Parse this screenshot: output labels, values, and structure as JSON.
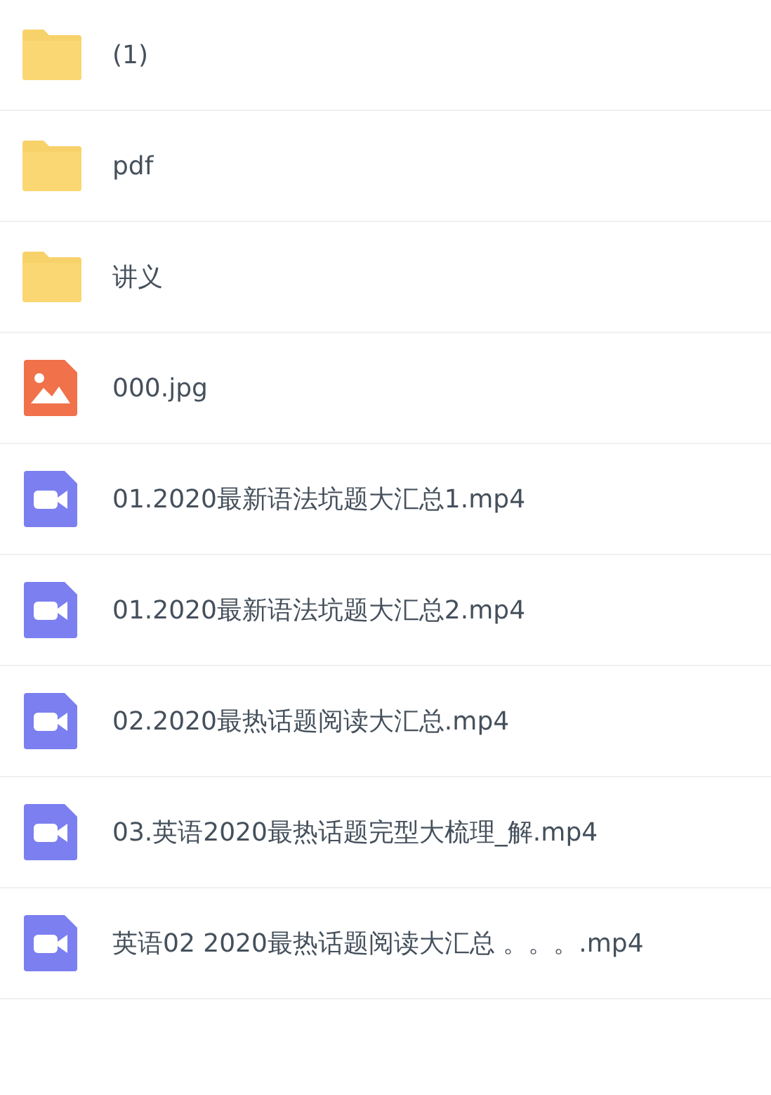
{
  "files": [
    {
      "kind": "folder",
      "name": "(1)"
    },
    {
      "kind": "folder",
      "name": "pdf"
    },
    {
      "kind": "folder",
      "name": "讲义"
    },
    {
      "kind": "image",
      "name": "000.jpg"
    },
    {
      "kind": "video",
      "name": "01.2020最新语法坑题大汇总1.mp4"
    },
    {
      "kind": "video",
      "name": "01.2020最新语法坑题大汇总2.mp4"
    },
    {
      "kind": "video",
      "name": "02.2020最热话题阅读大汇总.mp4"
    },
    {
      "kind": "video",
      "name": "03.英语2020最热话题完型大梳理_解.mp4"
    },
    {
      "kind": "video",
      "name": "英语02 2020最热话题阅读大汇总 。。。.mp4"
    }
  ]
}
